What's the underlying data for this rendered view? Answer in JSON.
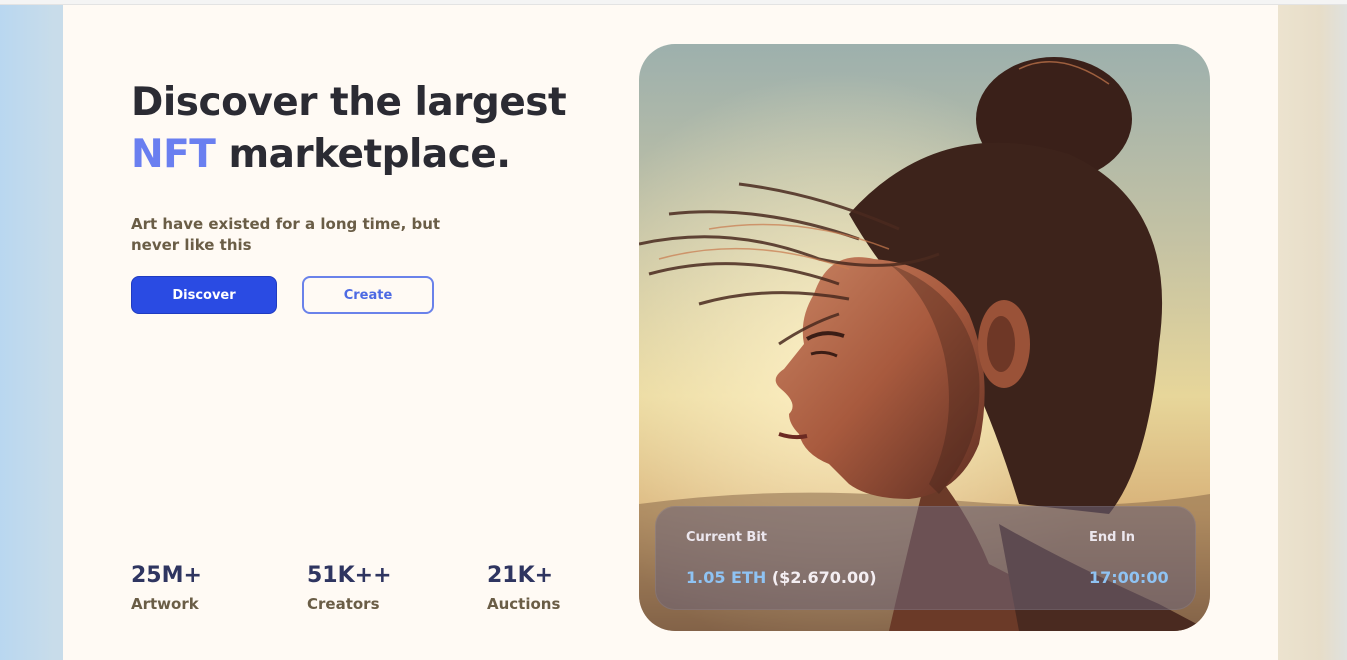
{
  "hero": {
    "headline_line1": "Discover the largest",
    "headline_accent": "NFT",
    "headline_rest": " marketplace.",
    "subtitle": "Art have existed for a long time, but never like this"
  },
  "buttons": {
    "discover": "Discover",
    "create": "Create"
  },
  "stats": [
    {
      "value": "25M+",
      "label": "Artwork"
    },
    {
      "value": "51K++",
      "label": "Creators"
    },
    {
      "value": "21K+",
      "label": "Auctions"
    }
  ],
  "artwork": {
    "image": "portrait-of-woman-with-windblown-hair",
    "bid": {
      "current_label": "Current Bit",
      "eth": "1.05 ETH",
      "usd": " ($2.670.00)",
      "end_label": "End In",
      "end_time": "17:00:00"
    }
  },
  "colors": {
    "accent": "#6a7ff0",
    "primary_button": "#2a4be3",
    "stat_number": "#2f3560",
    "text_brown": "#6a5d46"
  }
}
